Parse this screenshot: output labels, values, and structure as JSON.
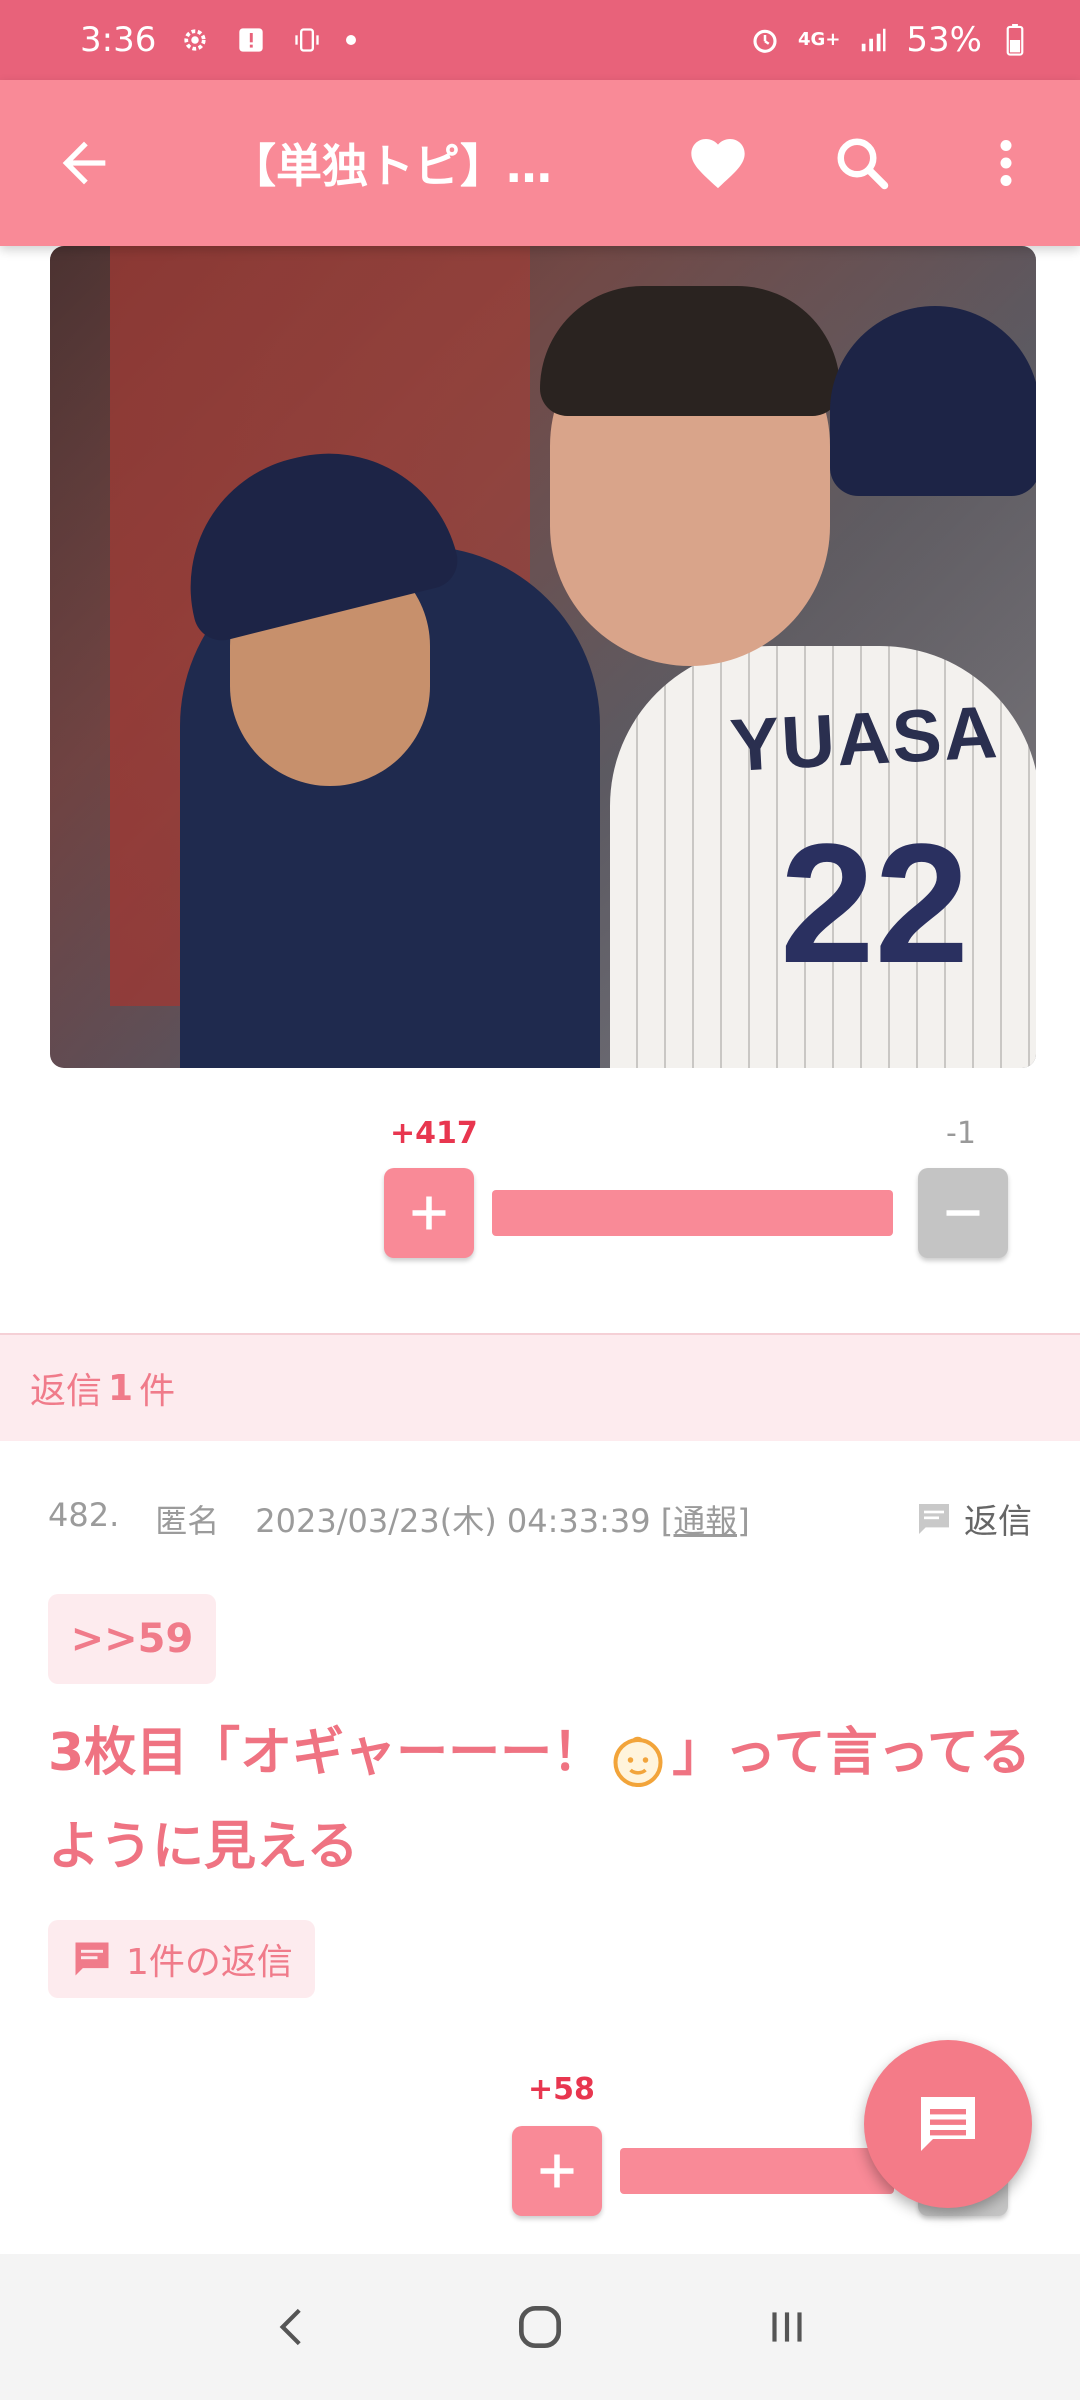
{
  "status_bar": {
    "time": "3:36",
    "network": "4G+",
    "battery": "53%"
  },
  "app_bar": {
    "title": "【単独トピ】…"
  },
  "post": {
    "photo": {
      "jersey_text": "YUASA",
      "jersey_number": "22"
    },
    "votes": {
      "plus": "+417",
      "minus": "-1",
      "plus_ratio": 0.998
    }
  },
  "reply_band": {
    "prefix": "返信",
    "count": "1",
    "suffix": "件"
  },
  "comment": {
    "number": "482.",
    "author": "匿名",
    "datetime": "2023/03/23(木) 04:33:39",
    "report": "[通報]",
    "reply_label": "返信",
    "anchor": ">>59",
    "body_before": "3枚目「オギャーーー！",
    "body_after": "」って言ってるように見える",
    "replies_label": "1件の返信",
    "votes": {
      "plus": "+58"
    }
  },
  "colors": {
    "status_bar": "#e8627a",
    "app_bar": "#f98a97",
    "accent_text": "#ef7382",
    "plus_count": "#e8364f"
  }
}
